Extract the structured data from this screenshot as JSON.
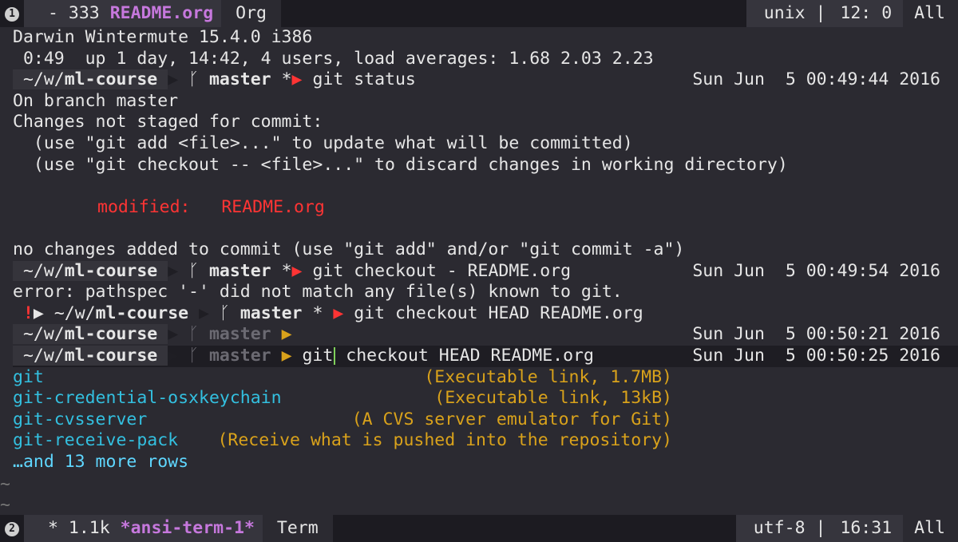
{
  "modeline_top": {
    "window_number": "1",
    "indicator": "-",
    "size": "333",
    "buffer_name": "README.org",
    "mode": "Org",
    "encoding": "unix",
    "position": "12: 0",
    "scroll": "All"
  },
  "modeline_bottom": {
    "window_number": "2",
    "indicator": "*",
    "size": "1.1k",
    "buffer_name": "*ansi-term-1*",
    "mode": "Term",
    "encoding": "utf-8",
    "position": "16:31",
    "scroll": "All"
  },
  "terminal": {
    "uname": "Darwin Wintermute 15.4.0 i386",
    "uptime": " 0:49  up 1 day, 14:42, 4 users, load averages: 1.68 2.03 2.23",
    "prompt_dir_prefix": "~/w/",
    "prompt_dir_bold": "ml-course",
    "branch_icon": "ᚴ",
    "branch": "master",
    "dirty_marker": "*",
    "cmd1": "git status",
    "time1": "Sun Jun  5 00:49:44 2016",
    "status_l1": "On branch master",
    "status_l2": "Changes not staged for commit:",
    "status_l3": "  (use \"git add <file>...\" to update what will be committed)",
    "status_l4": "  (use \"git checkout -- <file>...\" to discard changes in working directory)",
    "modified_label": "modified:",
    "modified_file": "README.org",
    "status_l6": "no changes added to commit (use \"git add\" and/or \"git commit -a\")",
    "cmd2": "git checkout - README.org",
    "time2": "Sun Jun  5 00:49:54 2016",
    "error_line": "error: pathspec '-' did not match any file(s) known to git.",
    "error_marker": "!",
    "cmd3": "git checkout HEAD README.org",
    "time3": "Sun Jun  5 00:50:21 2016",
    "cmd4_typed": "git",
    "cmd4_suggest": "checkout HEAD README.org",
    "time4": "Sun Jun  5 00:50:25 2016",
    "completions": [
      {
        "name": "git",
        "desc": "(Executable link, 1.7MB)"
      },
      {
        "name": "git-credential-osxkeychain",
        "desc": "(Executable link, 13kB)"
      },
      {
        "name": "git-cvsserver",
        "desc": "(A CVS server emulator for Git)"
      },
      {
        "name": "git-receive-pack",
        "desc": "(Receive what is pushed into the repository)"
      }
    ],
    "more_rows": "…and 13 more rows",
    "tilde": "~"
  },
  "colors": {
    "background": "#2b2a31",
    "error_red": "#ff3434",
    "completion_desc": "#d9a21b",
    "completion_name": "#33c0e0",
    "buffer_name": "#c678dd"
  }
}
